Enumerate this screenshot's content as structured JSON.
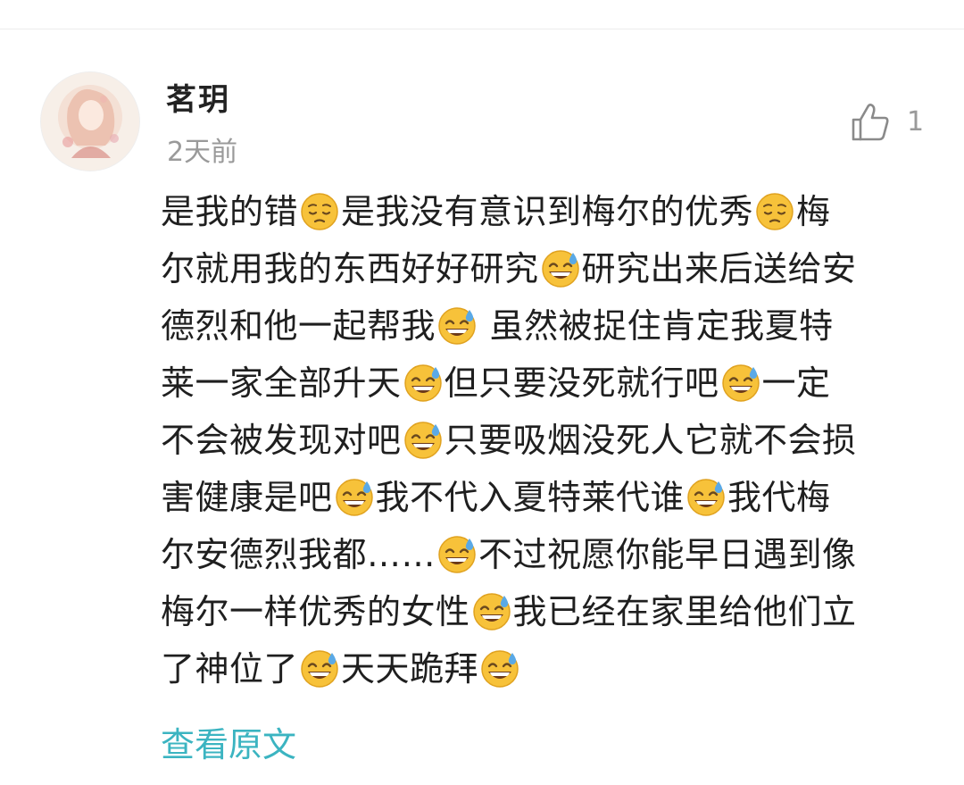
{
  "comment": {
    "username": "茗玥",
    "time": "2天前",
    "like_count": "1",
    "lines": [
      [
        {
          "t": "是我的错"
        },
        {
          "e": "pensive"
        },
        {
          "t": "是我没有意识到梅尔的优秀"
        },
        {
          "e": "pensive"
        },
        {
          "t": "梅"
        }
      ],
      [
        {
          "t": "尔就用我的东西好好研究"
        },
        {
          "e": "sweat"
        },
        {
          "t": "研究出来后送给安"
        }
      ],
      [
        {
          "t": "德烈和他一起帮我"
        },
        {
          "e": "sweat"
        },
        {
          "t": " 虽然被捉住肯定我夏特"
        }
      ],
      [
        {
          "t": "莱一家全部升天"
        },
        {
          "e": "sweat"
        },
        {
          "t": "但只要没死就行吧"
        },
        {
          "e": "sweat"
        },
        {
          "t": "一定"
        }
      ],
      [
        {
          "t": "不会被发现对吧"
        },
        {
          "e": "sweat"
        },
        {
          "t": "只要吸烟没死人它就不会损"
        }
      ],
      [
        {
          "t": "害健康是吧"
        },
        {
          "e": "sweat"
        },
        {
          "t": "我不代入夏特莱代谁"
        },
        {
          "e": "sweat"
        },
        {
          "t": "我代梅"
        }
      ],
      [
        {
          "t": "尔安德烈我都……"
        },
        {
          "e": "sweat"
        },
        {
          "t": "不过祝愿你能早日遇到像"
        }
      ],
      [
        {
          "t": "梅尔一样优秀的女性"
        },
        {
          "e": "sweat"
        },
        {
          "t": "我已经在家里给他们立"
        }
      ],
      [
        {
          "t": "了神位了"
        },
        {
          "e": "sweat"
        },
        {
          "t": "天天跪拜"
        },
        {
          "e": "sweat"
        }
      ]
    ],
    "view_original_label": "查看原文"
  },
  "icons": {
    "like": "thumbs-up-icon",
    "avatar": "avatar-illustration",
    "pensive": "pensive-face-emoji-icon",
    "sweat": "grinning-face-with-sweat-emoji-icon"
  },
  "colors": {
    "accent": "#3bb4c1",
    "secondary_text": "#9a9a9a",
    "primary_text": "#1f1f1f",
    "emoji_yellow": "#f7c23a",
    "sweat_blue": "#5aa9e6"
  }
}
